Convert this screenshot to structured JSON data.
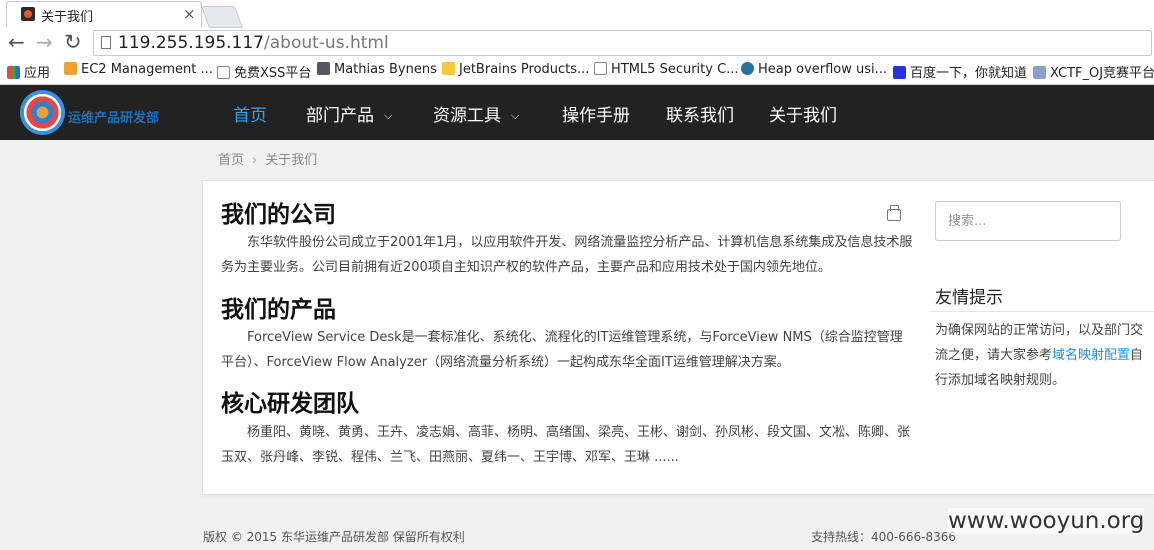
{
  "browser": {
    "tab_title": "关于我们",
    "url_host": "119.255.195.117",
    "url_path": "/about-us.html",
    "bookmarks": [
      "应用",
      "EC2 Management ...",
      "免费XSS平台",
      "Mathias Bynens",
      "JetBrains Products...",
      "HTML5 Security C...",
      "Heap overflow usi...",
      "百度一下，你就知道",
      "XCTF_OJ竞赛平台"
    ]
  },
  "site": {
    "logo_text": "运维产品研发部",
    "nav": [
      {
        "label": "首页"
      },
      {
        "label": "部门产品"
      },
      {
        "label": "资源工具"
      },
      {
        "label": "操作手册"
      },
      {
        "label": "联系我们"
      },
      {
        "label": "关于我们"
      }
    ]
  },
  "breadcrumb": {
    "home": "首页",
    "separator": "›",
    "current": "关于我们"
  },
  "content": {
    "sections": [
      {
        "title": "我们的公司",
        "body": "东华软件股份公司成立于2001年1月，以应用软件开发、网络流量监控分析产品、计算机信息系统集成及信息技术服务为主要业务。公司目前拥有近200项自主知识产权的软件产品，主要产品和应用技术处于国内领先地位。"
      },
      {
        "title": "我们的产品",
        "body": "ForceView Service Desk是一套标准化、系统化、流程化的IT运维管理系统，与ForceView NMS（综合监控管理平台）、ForceView Flow Analyzer（网络流量分析系统）一起构成东华全面IT运维管理解决方案。"
      },
      {
        "title": "核心研发团队",
        "body": "杨重阳、黄晓、黄勇、王卉、凌志娟、高菲、杨明、高绪国、梁亮、王彬、谢剑、孙凤彬、段文国、文凇、陈卿、张玉双、张丹峰、李锐、程伟、兰飞、田燕丽、夏纬一、王宇博、邓军、王琳 ......"
      }
    ]
  },
  "sidebar": {
    "search_placeholder": "搜索...",
    "tips_title": "友情提示",
    "tips_text_before": "为确保网站的正常访问，以及部门交流之便，请大家参考",
    "tips_link": "域名映射配置",
    "tips_text_after": "自行添加域名映射规则。"
  },
  "footer": {
    "copyright": "版权 © 2015 东华运维产品研发部 保留所有权利",
    "hotline": "支持热线：400-666-8366"
  },
  "watermark": "www.wooyun.org",
  "colors": {
    "nav_bg": "#222222",
    "nav_active": "#3aa0e8",
    "link": "#2a8fd8"
  }
}
